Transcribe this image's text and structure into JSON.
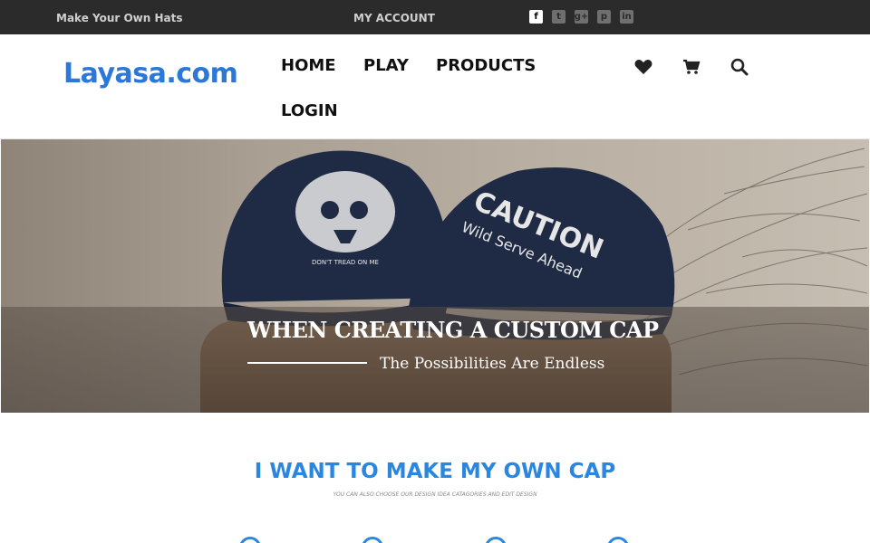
{
  "topbar": {
    "tagline": "Make Your Own Hats",
    "account": "MY ACCOUNT",
    "social": [
      {
        "icon": "facebook-icon",
        "glyph": "f"
      },
      {
        "icon": "twitter-icon",
        "glyph": "t"
      },
      {
        "icon": "google-plus-icon",
        "glyph": "g+"
      },
      {
        "icon": "pinterest-icon",
        "glyph": "p"
      },
      {
        "icon": "linkedin-icon",
        "glyph": "in"
      }
    ]
  },
  "header": {
    "logo": "Layasa.com",
    "nav": [
      "HOME",
      "PLAY",
      "PRODUCTS",
      "LOGIN"
    ],
    "icons": [
      "heart-icon",
      "cart-icon",
      "search-icon"
    ]
  },
  "hero": {
    "cap_left_text": "DON'T TREAD ON ME",
    "cap_right_text": "CAUTION",
    "cap_right_subtext": "Wild Serve Ahead",
    "headline": "WHEN CREATING A CUSTOM CAP",
    "subline": "The Possibilities Are Endless"
  },
  "section": {
    "title": "I WANT TO MAKE MY OWN CAP",
    "subtitle": "YOU CAN ALSO CHOOSE OUR DESIGN IDEA CATAGORIES AND EDIT DESIGN"
  },
  "colors": {
    "topbar_bg": "#2b2b2b",
    "brand_blue": "#2b78d9",
    "accent_blue": "#2b86e0",
    "cap_navy": "#1f2a44"
  }
}
